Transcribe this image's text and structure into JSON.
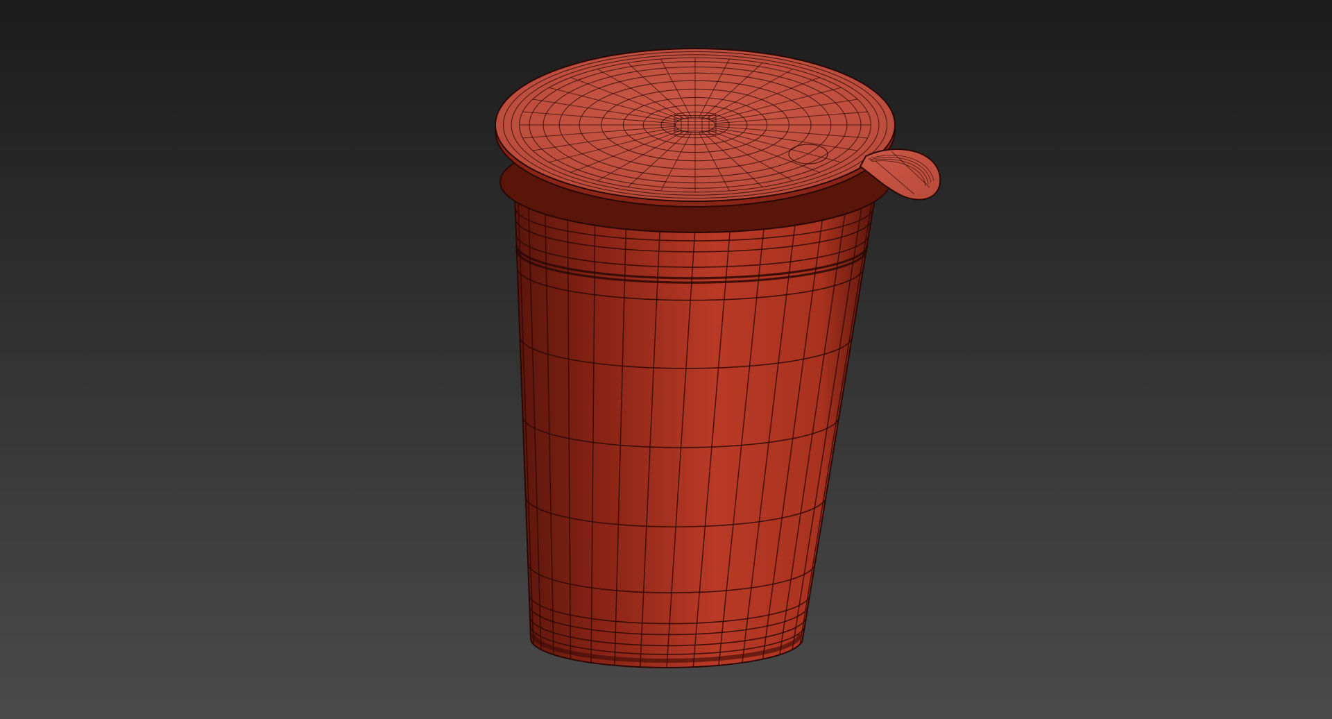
{
  "scene": {
    "subject": "cup-with-peel-lid-wireframe",
    "render_mode": "shaded-with-wireframe",
    "background": {
      "top_color": "#1c1c1c",
      "bottom_color": "#4a4a4a"
    },
    "colors": {
      "body_base": "#8a2416",
      "body_mid": "#a8321f",
      "body_light": "#b93a26",
      "body_dark": "#5a150b",
      "lid_base": "#b94a3a",
      "lid_light": "#cc5847",
      "wire": "#2a0805",
      "shadow": "#3a0a05"
    }
  }
}
